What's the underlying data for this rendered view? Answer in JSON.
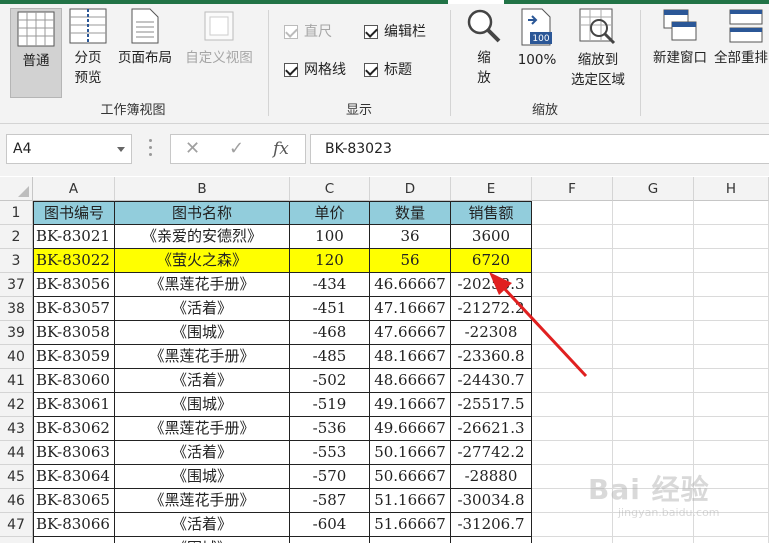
{
  "ribbon": {
    "workbook_views": {
      "label": "工作簿视图",
      "normal": "普通",
      "page_break_line1": "分页",
      "page_break_line2": "预览",
      "page_layout": "页面布局",
      "custom_views": "自定义视图"
    },
    "show": {
      "label": "显示",
      "ruler": "直尺",
      "formula_bar": "编辑栏",
      "gridlines": "网格线",
      "headings": "标题"
    },
    "zoom": {
      "label": "缩放",
      "zoom_line1": "缩",
      "zoom_line2": "放",
      "hundred": "100%",
      "zoom_sel_line1": "缩放到",
      "zoom_sel_line2": "选定区域",
      "hundred_icon_text": "100"
    },
    "window": {
      "new_window": "新建窗口",
      "arrange_all": "全部重排"
    }
  },
  "formula_bar": {
    "name_box": "A4",
    "formula": "BK-83023",
    "fx": "fx"
  },
  "columns": [
    "A",
    "B",
    "C",
    "D",
    "E",
    "F",
    "G",
    "H"
  ],
  "table": {
    "headers": [
      "图书编号",
      "图书名称",
      "单价",
      "数量",
      "销售额"
    ],
    "rows": [
      {
        "num": "2",
        "id": "BK-83021",
        "name": "《亲爱的安德烈》",
        "price": "100",
        "qty": "36",
        "sales": "3600"
      },
      {
        "num": "3",
        "id": "BK-83022",
        "name": "《萤火之森》",
        "price": "120",
        "qty": "56",
        "sales": "6720"
      },
      {
        "num": "37",
        "id": "BK-83056",
        "name": "《黑莲花手册》",
        "price": "-434",
        "qty": "46.66667",
        "sales": "-20253.3"
      },
      {
        "num": "38",
        "id": "BK-83057",
        "name": "《活着》",
        "price": "-451",
        "qty": "47.16667",
        "sales": "-21272.2"
      },
      {
        "num": "39",
        "id": "BK-83058",
        "name": "《围城》",
        "price": "-468",
        "qty": "47.66667",
        "sales": "-22308"
      },
      {
        "num": "40",
        "id": "BK-83059",
        "name": "《黑莲花手册》",
        "price": "-485",
        "qty": "48.16667",
        "sales": "-23360.8"
      },
      {
        "num": "41",
        "id": "BK-83060",
        "name": "《活着》",
        "price": "-502",
        "qty": "48.66667",
        "sales": "-24430.7"
      },
      {
        "num": "42",
        "id": "BK-83061",
        "name": "《围城》",
        "price": "-519",
        "qty": "49.16667",
        "sales": "-25517.5"
      },
      {
        "num": "43",
        "id": "BK-83062",
        "name": "《黑莲花手册》",
        "price": "-536",
        "qty": "49.66667",
        "sales": "-26621.3"
      },
      {
        "num": "44",
        "id": "BK-83063",
        "name": "《活着》",
        "price": "-553",
        "qty": "50.16667",
        "sales": "-27742.2"
      },
      {
        "num": "45",
        "id": "BK-83064",
        "name": "《围城》",
        "price": "-570",
        "qty": "50.66667",
        "sales": "-28880"
      },
      {
        "num": "46",
        "id": "BK-83065",
        "name": "《黑莲花手册》",
        "price": "-587",
        "qty": "51.16667",
        "sales": "-30034.8"
      },
      {
        "num": "47",
        "id": "BK-83066",
        "name": "《活着》",
        "price": "-604",
        "qty": "51.66667",
        "sales": "-31206.7"
      }
    ],
    "partial_row_name": "《围城》"
  },
  "colors": {
    "header_fill": "#92cddc",
    "highlight_fill": "#ffff00",
    "accent": "#217346",
    "arrow": "#e02020"
  },
  "watermark": {
    "line1": "Bai 经验",
    "line2": "jingyan.baidu.com"
  }
}
